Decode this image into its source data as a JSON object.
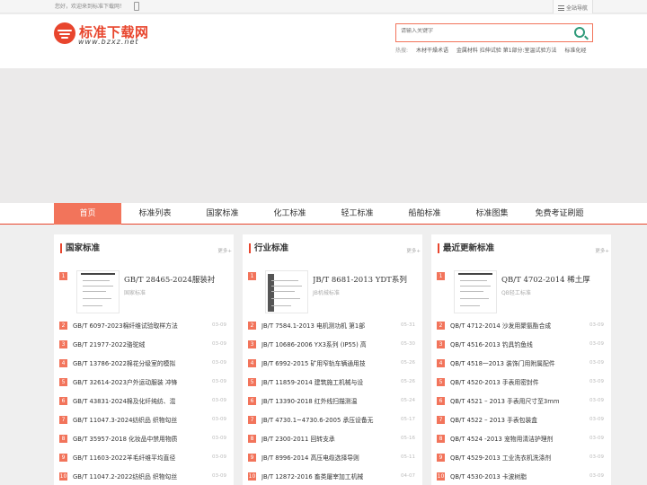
{
  "topbar": {
    "welcome": "您好，欢迎来到标准下载网！",
    "site_nav": "全站导航"
  },
  "logo": {
    "title": "标准下载网",
    "subtitle": "www.bzxz.net"
  },
  "search": {
    "placeholder": "请输入关键字",
    "hot_label": "热搜:",
    "hot_keywords": [
      "木材干燥术语",
      "金属材料 拉伸试验 第1部分:室温试验方法",
      "标准化经"
    ]
  },
  "nav": [
    "首页",
    "标准列表",
    "国家标准",
    "化工标准",
    "轻工标准",
    "船舶标准",
    "标准图集",
    "免费考证刷题"
  ],
  "more_label": "更多+",
  "panels": [
    {
      "title": "国家标准",
      "featured": {
        "num": "1",
        "title": "GB/T 28465-2024服装衬",
        "category": "国家标准"
      },
      "rows": [
        {
          "num": "2",
          "title": "GB/T 6097-2023棉纤维试验取样方法",
          "date": "03-09"
        },
        {
          "num": "3",
          "title": "GB/T 21977-2022骆驼绒",
          "date": "03-09"
        },
        {
          "num": "4",
          "title": "GB/T 13786-2022棉花分级室的模拟",
          "date": "03-09"
        },
        {
          "num": "5",
          "title": "GB/T 32614-2023户外运动服装 冲锋",
          "date": "03-09"
        },
        {
          "num": "6",
          "title": "GB/T 43831-2024棉及化纤纯纺、混",
          "date": "03-09"
        },
        {
          "num": "7",
          "title": "GB/T 11047.3-2024纺织品 织物勾丝",
          "date": "03-09"
        },
        {
          "num": "8",
          "title": "GB/T 35957-2018 化妆品中禁用物质",
          "date": "03-09"
        },
        {
          "num": "9",
          "title": "GB/T 11603-2022羊毛纤维平均直径",
          "date": "03-09"
        },
        {
          "num": "10",
          "title": "GB/T 11047.2-2022纺织品 织物勾丝",
          "date": "03-09"
        }
      ]
    },
    {
      "title": "行业标准",
      "featured": {
        "num": "1",
        "title": "JB/T 8681-2013 YDT系列",
        "category": "JB机械标准"
      },
      "rows": [
        {
          "num": "2",
          "title": "JB/T 7584.1-2013 电机测功机 第1部",
          "date": "05-31"
        },
        {
          "num": "3",
          "title": "JB/T 10686-2006 YX3系列 (IP55) 高",
          "date": "05-30"
        },
        {
          "num": "4",
          "title": "JB/T 6992-2015 矿用窄轨车辆通用技",
          "date": "05-26"
        },
        {
          "num": "5",
          "title": "JB/T 11859-2014 建筑施工机械与设",
          "date": "05-26"
        },
        {
          "num": "6",
          "title": "JB/T 13390-2018 红外线扫描测温",
          "date": "05-24"
        },
        {
          "num": "7",
          "title": "JB/T 4730.1~4730.6-2005 承压设备无",
          "date": "05-17"
        },
        {
          "num": "8",
          "title": "JB/T 2300-2011 回转支承",
          "date": "05-16"
        },
        {
          "num": "9",
          "title": "JB/T 8996-2014 高压电缆选择导则",
          "date": "05-11"
        },
        {
          "num": "10",
          "title": "JB/T 12872-2016 畜类屠宰加工机械",
          "date": "04-07"
        }
      ]
    },
    {
      "title": "最近更新标准",
      "featured": {
        "num": "1",
        "title": "QB/T 4702-2014 稀土厚",
        "category": "QB轻工标准"
      },
      "rows": [
        {
          "num": "2",
          "title": "QB/T 4712-2014 沙发用聚氨酯合成",
          "date": "03-09"
        },
        {
          "num": "3",
          "title": "QB/T 4516-2013 钓具钓鱼线",
          "date": "03-09"
        },
        {
          "num": "4",
          "title": "QB/T 4518一2013 装饰门用附属配件",
          "date": "03-09"
        },
        {
          "num": "5",
          "title": "QB/T 4520-2013 手表用密封件",
          "date": "03-09"
        },
        {
          "num": "6",
          "title": "QB/T 4521 – 2013 手表用尺寸至3mm",
          "date": "03-09"
        },
        {
          "num": "7",
          "title": "QB/T 4522 – 2013 手表包装盒",
          "date": "03-09"
        },
        {
          "num": "8",
          "title": "QB/T 4524 -2013 宠物用清洁护理剂",
          "date": "03-09"
        },
        {
          "num": "9",
          "title": "QB/T 4529-2013 工业洗衣机洗涤剂",
          "date": "03-09"
        },
        {
          "num": "10",
          "title": "QB/T 4530-2013 卡波树脂",
          "date": "03-09"
        }
      ]
    }
  ]
}
